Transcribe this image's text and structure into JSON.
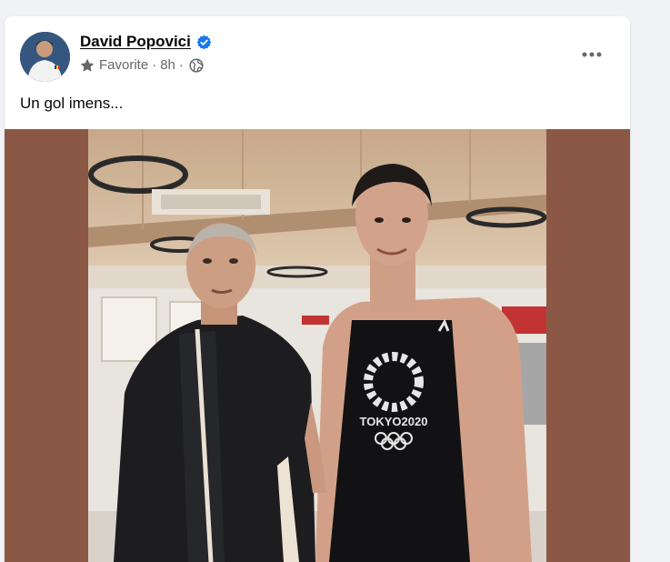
{
  "post": {
    "author": {
      "name": "David Popovici",
      "verified": true,
      "verified_icon": "verified-badge-icon",
      "avatar_icon": "profile-avatar"
    },
    "meta": {
      "audience_label": "Favorite",
      "audience_icon": "star-icon",
      "separator": "·",
      "time": "8h",
      "privacy_icon": "globe-icon"
    },
    "menu_icon": "more-options-icon",
    "text": "Un gol imens...",
    "photo": {
      "shirt_text": "TOKYO2020",
      "content": "two-men-posing-photo"
    }
  },
  "colors": {
    "background": "#f0f2f5",
    "card": "#ffffff",
    "verified_blue": "#1877f2",
    "secondary_text": "#65676b",
    "media_background": "#8b5846"
  }
}
